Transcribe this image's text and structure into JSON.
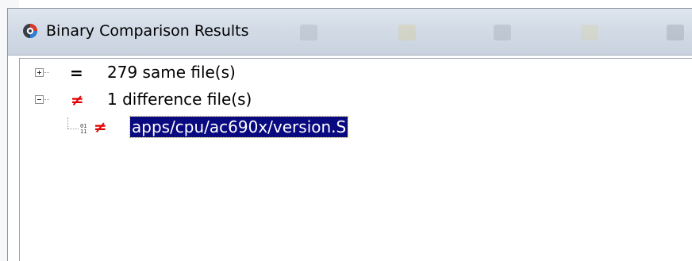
{
  "window": {
    "title": "Binary Comparison Results"
  },
  "tree": {
    "groups": [
      {
        "expanded": false,
        "symbol": "=",
        "label": "279 same file(s)"
      },
      {
        "expanded": true,
        "symbol": "≠",
        "label": "1 difference file(s)",
        "children": [
          {
            "icon_text_top": "01",
            "icon_text_bottom": "11",
            "symbol": "≠",
            "label": "apps/cpu/ac690x/version.S",
            "selected": true
          }
        ]
      }
    ]
  },
  "colors": {
    "different": "#e00000",
    "selection_bg": "#0a0a80",
    "selection_fg": "#ffffff"
  },
  "icons": {
    "app": "compare-app-icon",
    "binary_file": "binary-file-icon"
  }
}
